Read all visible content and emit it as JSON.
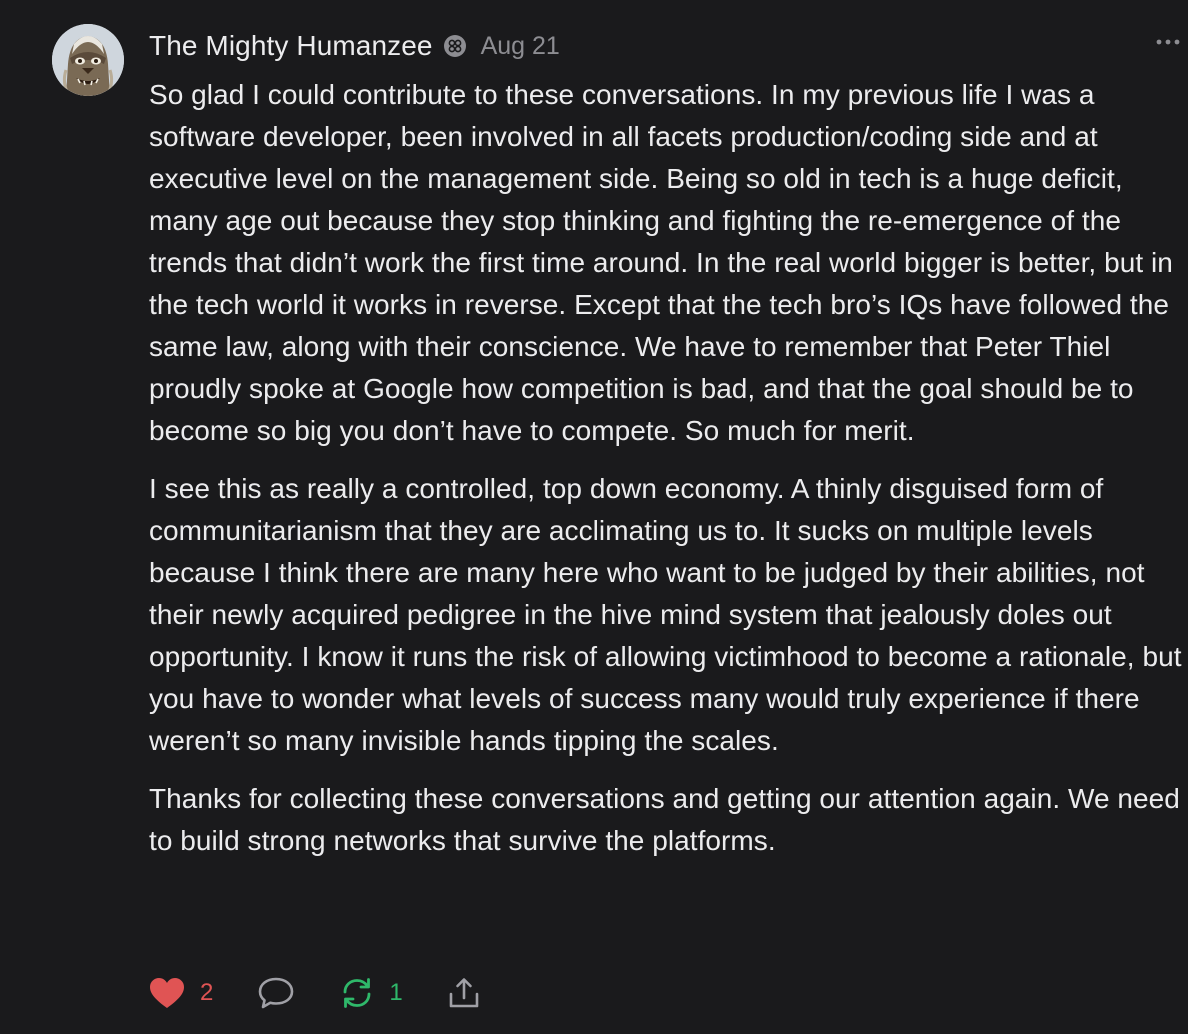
{
  "post": {
    "author": "The Mighty Humanzee",
    "author_badge_icon": "verified-badge-icon",
    "date": "Aug 21",
    "more_icon": "more-options-icon",
    "paragraphs": [
      "So glad I could contribute to these conversations. In my previous life I was a software developer, been involved in all facets production/coding side and at executive level on the management side. Being so old in tech is a huge deficit, many age out because they stop thinking and fighting the re-emergence of the trends that didn’t work the first time around. In the real world bigger is better, but in the tech world it works in reverse. Except that the tech bro’s IQs have followed the same law, along with their conscience. We have to remember that Peter Thiel proudly spoke at Google how competition is bad, and that the goal should be to become so big you don’t have to compete. So much for merit.",
      "I see this as really a controlled, top down economy. A thinly disguised form of communitarianism that they are acclimating us to. It sucks on multiple levels because I think there are many here who want to be judged by their abilities, not their newly acquired pedigree in the hive mind system that jealously doles out opportunity. I know it runs the risk of allowing victimhood to become a rationale, but you have to wonder what levels of success many would truly experience if there weren’t so many invisible hands tipping the scales.",
      "Thanks for collecting these conversations and getting our attention again. We need to build strong networks that survive the platforms."
    ]
  },
  "actions": {
    "like": {
      "icon": "heart-icon",
      "count": "2",
      "color": "#e05454"
    },
    "reply": {
      "icon": "comment-icon"
    },
    "restack": {
      "icon": "restack-icon",
      "count": "1",
      "color": "#2fb86a"
    },
    "share": {
      "icon": "share-icon"
    }
  }
}
